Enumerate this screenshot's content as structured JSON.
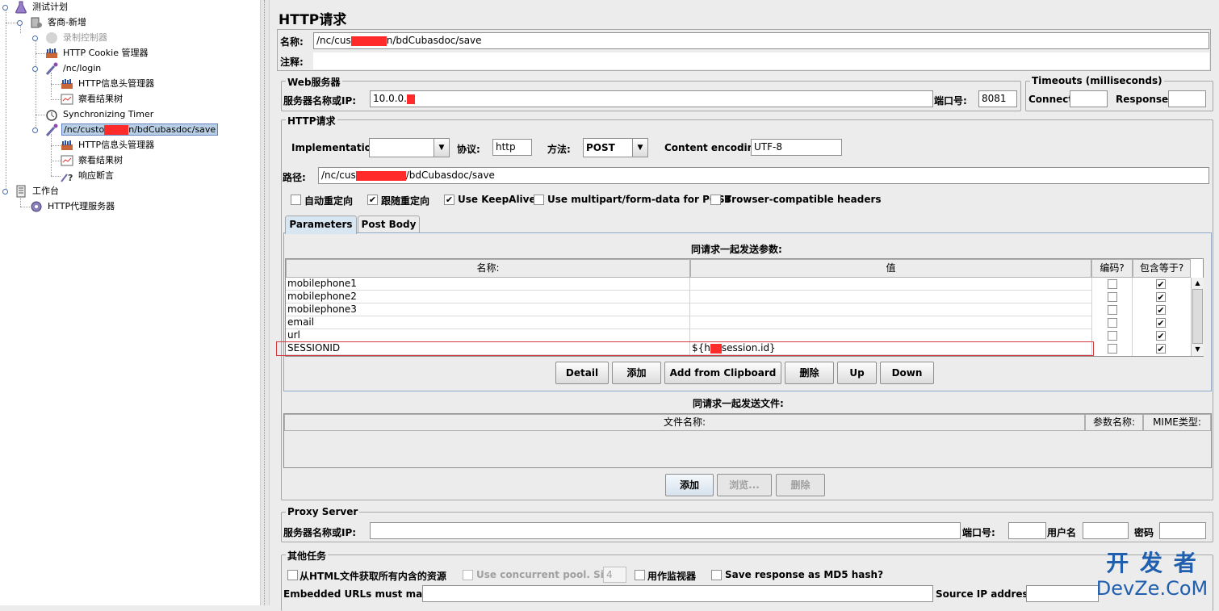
{
  "tree": {
    "nodes": [
      {
        "label": "测试计划",
        "icon": "flask-icon"
      },
      {
        "label": "客商-新增",
        "icon": "thread-group-icon"
      },
      {
        "label": "录制控制器",
        "icon": "recording-controller-icon"
      },
      {
        "label": "HTTP Cookie 管理器",
        "icon": "config-element-icon"
      },
      {
        "label": "/nc/login",
        "icon": "sampler-pipette-icon"
      },
      {
        "label": "HTTP信息头管理器",
        "icon": "config-element-icon"
      },
      {
        "label": "察看结果树",
        "icon": "listener-icon"
      },
      {
        "label": "Synchronizing Timer",
        "icon": "timer-icon"
      },
      {
        "label_pre": "/nc/custo",
        "label_post": "n/bdCubasdoc/save",
        "icon": "sampler-pipette-icon"
      },
      {
        "label": "HTTP信息头管理器",
        "icon": "config-element-icon"
      },
      {
        "label": "察看结果树",
        "icon": "listener-icon"
      },
      {
        "label": "响应断言",
        "icon": "assertion-icon"
      },
      {
        "label": "工作台",
        "icon": "workbench-icon"
      },
      {
        "label": "HTTP代理服务器",
        "icon": "proxy-server-icon"
      }
    ]
  },
  "panel": {
    "title": "HTTP请求",
    "name_label": "名称:",
    "name_pre": "/nc/cus",
    "name_post": "n/bdCubasdoc/save",
    "comment_label": "注释:",
    "web_server": {
      "title": "Web服务器",
      "server_label": "服务器名称或IP:",
      "server_value": "10.0.0.",
      "port_label": "端口号:",
      "port_value": "8081"
    },
    "timeouts": {
      "title": "Timeouts (milliseconds)",
      "connect_label": "Connect:",
      "response_label": "Response:"
    },
    "http_request": {
      "title": "HTTP请求",
      "implementation_label": "Implementation:",
      "protocol_label": "协议:",
      "protocol_value": "http",
      "method_label": "方法:",
      "method_value": "POST",
      "encoding_label": "Content encoding:",
      "encoding_value": "UTF-8",
      "path_label": "路径:",
      "path_pre": "/nc/cus",
      "path_post": "/bdCubasdoc/save",
      "options": [
        {
          "label": "自动重定向",
          "checked": false
        },
        {
          "label": "跟随重定向",
          "checked": true
        },
        {
          "label": "Use KeepAlive",
          "checked": true
        },
        {
          "label": "Use multipart/form-data for POST",
          "checked": false
        },
        {
          "label": "Browser-compatible headers",
          "checked": false
        }
      ]
    },
    "tabs": [
      "Parameters",
      "Post Body"
    ],
    "params": {
      "caption": "同请求一起发送参数:",
      "columns": [
        "名称:",
        "值",
        "编码?",
        "包含等于?"
      ],
      "rows": [
        {
          "name": "mobilephone1",
          "value": "",
          "encode": false,
          "include_equals": true
        },
        {
          "name": "mobilephone2",
          "value": "",
          "encode": false,
          "include_equals": true
        },
        {
          "name": "mobilephone3",
          "value": "",
          "encode": false,
          "include_equals": true
        },
        {
          "name": "email",
          "value": "",
          "encode": false,
          "include_equals": true
        },
        {
          "name": "url",
          "value": "",
          "encode": false,
          "include_equals": true
        },
        {
          "name": "SESSIONID",
          "value_pre": "${h",
          "value_post": "session.id}",
          "encode": false,
          "include_equals": true
        }
      ],
      "buttons": [
        "Detail",
        "添加",
        "Add from Clipboard",
        "删除",
        "Up",
        "Down"
      ]
    },
    "files": {
      "caption": "同请求一起发送文件:",
      "columns": [
        "文件名称:",
        "参数名称:",
        "MIME类型:"
      ],
      "buttons": [
        "添加",
        "浏览...",
        "删除"
      ]
    },
    "proxy": {
      "title": "Proxy Server",
      "server_label": "服务器名称或IP:",
      "port_label": "端口号:",
      "user_label": "用户名",
      "password_label": "密码"
    },
    "other": {
      "title": "其他任务",
      "fetch_label": "从HTML文件获取所有内含的资源",
      "concurrent_label": "Use concurrent pool. Size:",
      "concurrent_value": "4",
      "monitor_label": "用作监视器",
      "md5_label": "Save response as MD5 hash?",
      "embedded_label": "Embedded URLs must match:",
      "source_ip_label": "Source IP address:"
    }
  },
  "watermark": {
    "line1": "开 发 者",
    "line2": "DevZe.CoM"
  }
}
